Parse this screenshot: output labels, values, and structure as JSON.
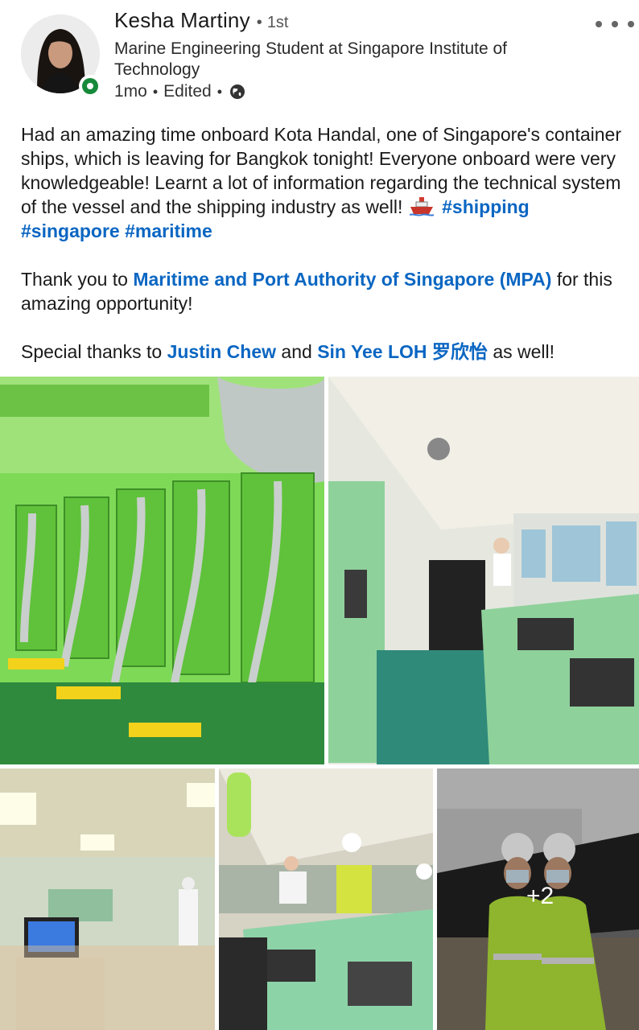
{
  "author": {
    "name": "Kesha Martiny",
    "connection_degree": "1st",
    "headline": "Marine Engineering Student at Singapore Institute of Technology",
    "time_posted": "1mo",
    "edited_label": "Edited",
    "visibility_icon": "globe-icon",
    "status_color": "#168a3a"
  },
  "post": {
    "paragraph1": "Had an amazing time onboard Kota Handal, one of Singapore's container ships, which is leaving for Bangkok tonight! Everyone onboard were very knowledgeable! Learnt a lot of information regarding the technical system of the vessel and the shipping industry as well!",
    "hashtags": [
      "#shipping",
      "#singapore",
      "#maritime"
    ],
    "thanks_prefix": "Thank you to",
    "thanks_org": "Maritime and Port Authority of Singapore (MPA)",
    "thanks_suffix": "for this amazing opportunity!",
    "special_prefix": "Special thanks to",
    "mention1": "Justin Chew",
    "special_and": "and",
    "mention2": "Sin Yee LOH 罗欣怡",
    "special_suffix": "as well!",
    "link_color": "#0a66c2"
  },
  "media": {
    "extra_count_label": "+2"
  }
}
